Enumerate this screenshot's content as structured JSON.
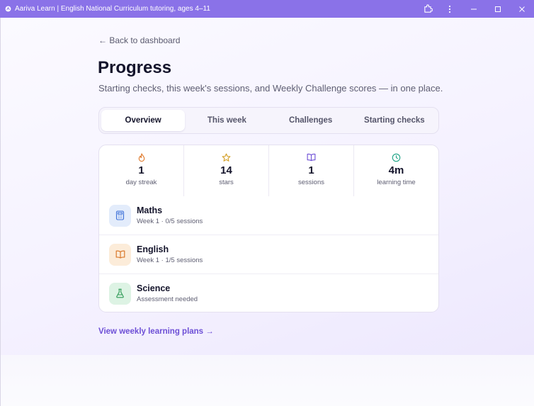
{
  "window": {
    "title": "Aariva Learn | English National Curriculum tutoring, ages 4–11",
    "colors": {
      "titlebar": "#8a72e8",
      "accent": "#6d4fd6"
    }
  },
  "page": {
    "back_label": "← Back to dashboard",
    "title": "Progress",
    "subtitle": "Starting checks, this week's sessions, and Weekly Challenge scores — in one place."
  },
  "tabs": [
    {
      "label": "Overview",
      "active": true
    },
    {
      "label": "This week",
      "active": false
    },
    {
      "label": "Challenges",
      "active": false
    },
    {
      "label": "Starting checks",
      "active": false
    }
  ],
  "stats": [
    {
      "icon": "flame-icon",
      "value": "1",
      "label": "day streak",
      "color": "#e07b2e"
    },
    {
      "icon": "star-icon",
      "value": "14",
      "label": "stars",
      "color": "#d4a12a"
    },
    {
      "icon": "book-icon",
      "value": "1",
      "label": "sessions",
      "color": "#6d4fd6"
    },
    {
      "icon": "clock-icon",
      "value": "4m",
      "label": "learning time",
      "color": "#1ea386"
    }
  ],
  "subjects": [
    {
      "icon": "calculator-icon",
      "name": "Maths",
      "meta": "Week 1 · 0/5 sessions",
      "color": "#3b6fd8",
      "bg": "#e3ecfb"
    },
    {
      "icon": "book-icon",
      "name": "English",
      "meta": "Week 1 · 1/5 sessions",
      "color": "#d9792c",
      "bg": "#fcecd9"
    },
    {
      "icon": "flask-icon",
      "name": "Science",
      "meta": "Assessment needed",
      "color": "#2d9a55",
      "bg": "#ddf3e4"
    }
  ],
  "plans_link": "View weekly learning plans →"
}
